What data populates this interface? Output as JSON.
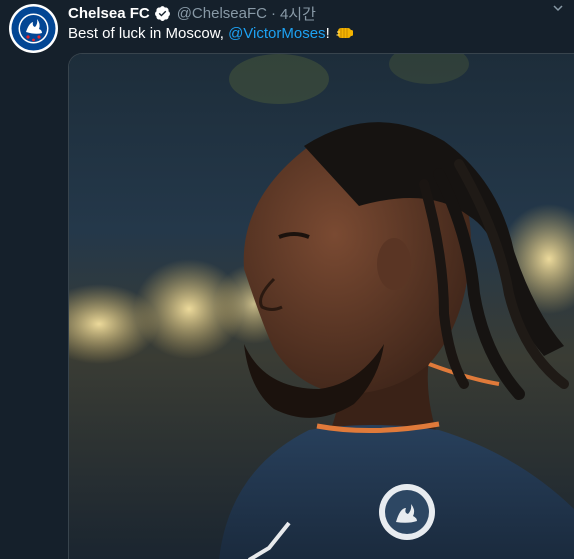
{
  "tweet": {
    "author_name": "Chelsea FC",
    "handle": "@ChelseaFC",
    "separator": "·",
    "timestamp": "4시간",
    "text_before": "Best of luck in Moscow, ",
    "mention": "@VictorMoses",
    "text_after": "!",
    "emoji": "fist-bump",
    "verified": true,
    "more_icon": "chevron-down-icon"
  },
  "colors": {
    "background": "#15202b",
    "link": "#1da1f2",
    "secondary_text": "#8899a6",
    "verified_badge": "#ffffff",
    "chelsea_blue": "#034694"
  }
}
